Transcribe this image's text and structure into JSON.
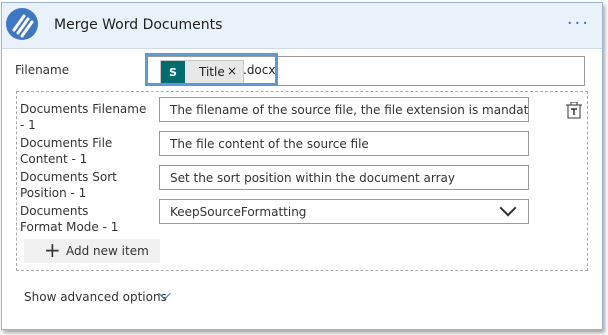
{
  "header": {
    "title": "Merge Word Documents",
    "more": "···"
  },
  "filename": {
    "label": "Filename",
    "token": {
      "icon": "S",
      "label": "Title",
      "close": "×"
    },
    "suffix": ".docx"
  },
  "documents": {
    "filename_label": "Documents Filename - 1",
    "filename_value": "The filename of the source file, the file extension is mandatory: 'file.docx' and not 'file'",
    "content_label": "Documents File Content - 1",
    "content_value": "The file content of the source file",
    "sort_label": "Documents Sort Position - 1",
    "sort_value": "Set the sort position within the document array",
    "format_label": "Documents Format Mode - 1",
    "format_value": "KeepSourceFormatting"
  },
  "add_item": {
    "plus": "+",
    "label": "Add new item"
  },
  "advanced": {
    "label": "Show advanced options"
  }
}
